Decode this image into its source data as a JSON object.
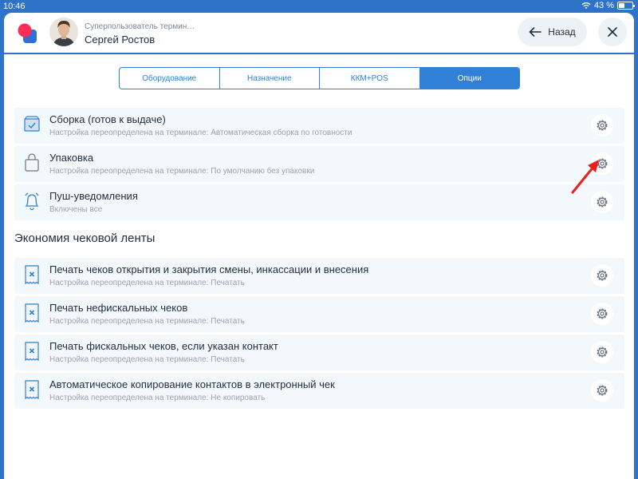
{
  "status_bar": {
    "time": "10:46",
    "battery_text": "43 %",
    "battery_level": 0.43
  },
  "header": {
    "user_role": "Суперпользователь термин…",
    "user_name": "Сергей Ростов",
    "back_label": "Назад"
  },
  "tabs": [
    {
      "label": "Оборудование",
      "active": false
    },
    {
      "label": "Назначение",
      "active": false
    },
    {
      "label": "ККМ+POS",
      "active": false
    },
    {
      "label": "Опции",
      "active": true
    }
  ],
  "options": [
    {
      "title": "Сборка (готов к выдаче)",
      "subtitle": "Настройка переопределена на терминале: Автоматическая сборка по готовности",
      "icon": "box-icon"
    },
    {
      "title": "Упаковка",
      "subtitle": "Настройка переопределена на терминале: По умолчанию без упаковки",
      "icon": "bag-icon"
    },
    {
      "title": "Пуш-уведомления",
      "subtitle": "Включены все",
      "icon": "bell-icon"
    }
  ],
  "section_title": "Экономия чековой ленты",
  "receipt_options": [
    {
      "title": "Печать чеков открытия и закрытия смены, инкассации и внесения",
      "subtitle": "Настройка переопределена на терминале: Печатать",
      "icon": "receipt-icon"
    },
    {
      "title": "Печать нефискальных чеков",
      "subtitle": "Настройка переопределена на терминале: Печатать",
      "icon": "receipt-icon"
    },
    {
      "title": "Печать фискальных чеков, если указан контакт",
      "subtitle": "Настройка переопределена на терминале: Печатать",
      "icon": "receipt-icon"
    },
    {
      "title": "Автоматическое копирование контактов в электронный чек",
      "subtitle": "Настройка переопределена на терминале: Не копировать",
      "icon": "receipt-icon"
    }
  ],
  "colors": {
    "accent": "#2f80d6",
    "row_bg": "#f3f8fd",
    "brand_red": "#ff2d55",
    "brand_blue": "#2f6fd6",
    "pointer": "#e8211f"
  }
}
